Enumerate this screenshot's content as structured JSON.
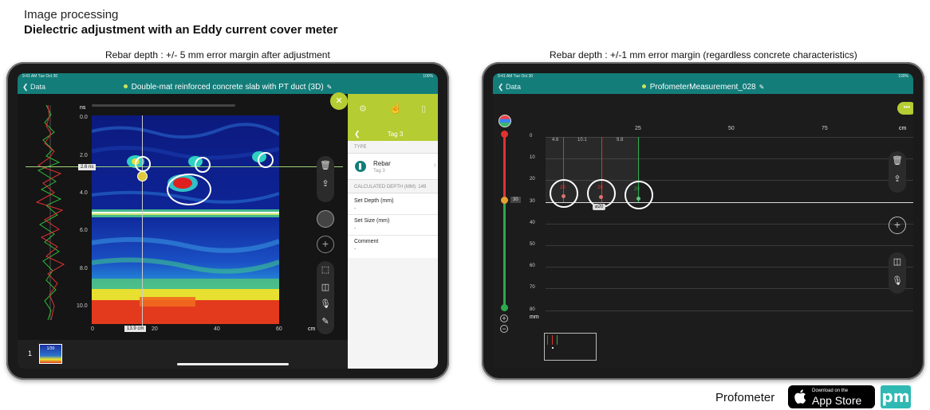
{
  "heading": {
    "line1": "Image processing",
    "line2": "Dielectric adjustment with an Eddy current cover meter"
  },
  "left": {
    "caption": "Rebar depth : +/- 5 mm error margin after adjustment",
    "status_time": "9:41 AM  Tue Oct 30",
    "status_battery": "100%",
    "nav_back": "Data",
    "nav_title": "Double-mat reinforced concrete slab with PT duct (3D)",
    "y_unit": "ns",
    "y_ticks": [
      "0.0",
      "2.0",
      "4.0",
      "6.0",
      "8.0",
      "10.0"
    ],
    "time_marker": "2.6 ns",
    "x_unit": "cm",
    "x_ticks": [
      "0",
      "20",
      "40",
      "60"
    ],
    "x_marker": "13.9 cm",
    "thumb_index": "1",
    "thumb_label": "1/30",
    "panel": {
      "tab_title": "Tag 3",
      "type_caption": "TYPE",
      "type_name": "Rebar",
      "type_sub": "Tag 3",
      "calc_depth": "CALCULATED DEPTH (MM): 149",
      "set_depth_label": "Set Depth (mm)",
      "set_depth_value": "-",
      "set_size_label": "Set Size (mm)",
      "set_size_value": "-",
      "comment_label": "Comment",
      "comment_value": "-"
    },
    "colors": {
      "accent": "#137d7a",
      "panel_accent": "#b5cc32"
    }
  },
  "right": {
    "caption": "Rebar depth : +/-1 mm error margin (regardless concrete characteristics)",
    "status_time": "9:41 AM  Tue Oct 30",
    "status_battery": "100%",
    "nav_back": "Data",
    "nav_title": "ProfometerMeasurement_028",
    "x_unit": "cm",
    "x_ticks": [
      "25",
      "50",
      "75"
    ],
    "y_unit": "mm",
    "y_ticks": [
      "0",
      "10",
      "20",
      "30",
      "40",
      "50",
      "60",
      "70",
      "80"
    ],
    "slider_value": "30",
    "spacings": [
      "4.6",
      "10.1",
      "9.8"
    ],
    "bar_labels": [
      "28",
      "28",
      "29"
    ],
    "diameter": "⌀20"
  },
  "branding": {
    "product": "Profometer",
    "store_small": "Download on the",
    "store_big": "App Store",
    "logo": "pm"
  }
}
